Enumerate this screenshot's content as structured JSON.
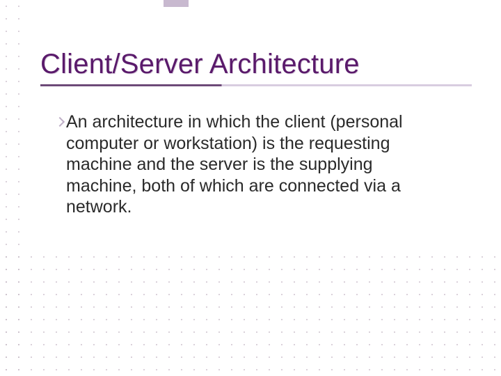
{
  "slide": {
    "title": "Client/Server Architecture",
    "body": "An architecture in which the client (personal computer or workstation) is the requesting machine and the server is the supplying machine, both of which are connected via a network."
  }
}
